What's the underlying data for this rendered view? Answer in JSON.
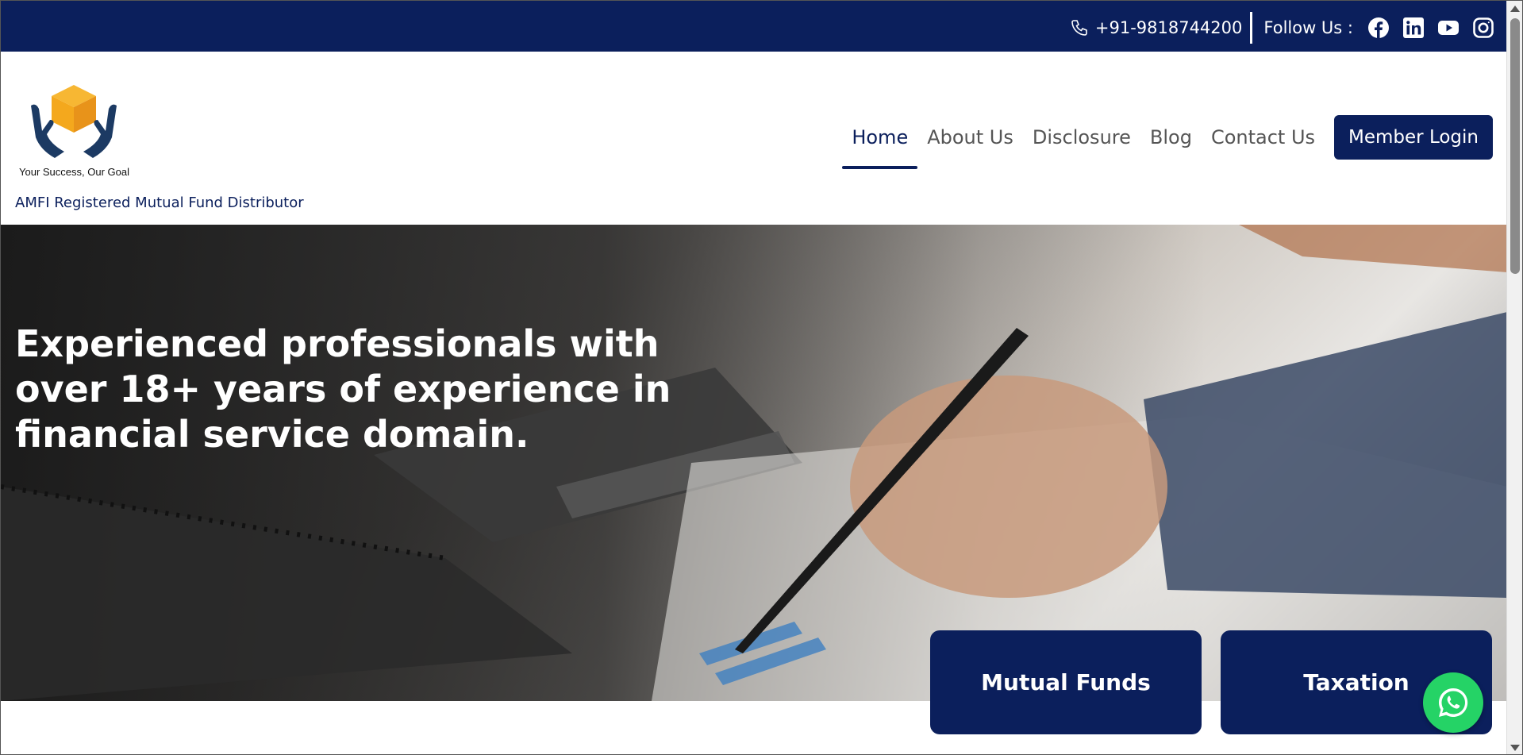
{
  "topbar": {
    "phone": "+91-9818744200",
    "follow_label": "Follow Us :",
    "social": [
      "facebook-icon",
      "linkedin-icon",
      "youtube-icon",
      "instagram-icon"
    ]
  },
  "header": {
    "logo_tagline": "Your Success, Our Goal",
    "subtitle": "AMFI Registered Mutual Fund Distributor"
  },
  "nav": {
    "items": [
      {
        "label": "Home",
        "active": true
      },
      {
        "label": "About Us"
      },
      {
        "label": "Disclosure"
      },
      {
        "label": "Blog"
      },
      {
        "label": "Contact Us"
      }
    ],
    "login": "Member Login"
  },
  "hero": {
    "title": "Experienced professionals with over 18+ years of experience in financial service domain."
  },
  "cards": [
    {
      "label": "Mutual Funds"
    },
    {
      "label": "Taxation"
    }
  ],
  "colors": {
    "brand_navy": "#0b1f5c",
    "logo_gold": "#f4a81d",
    "whatsapp_green": "#25d366"
  }
}
